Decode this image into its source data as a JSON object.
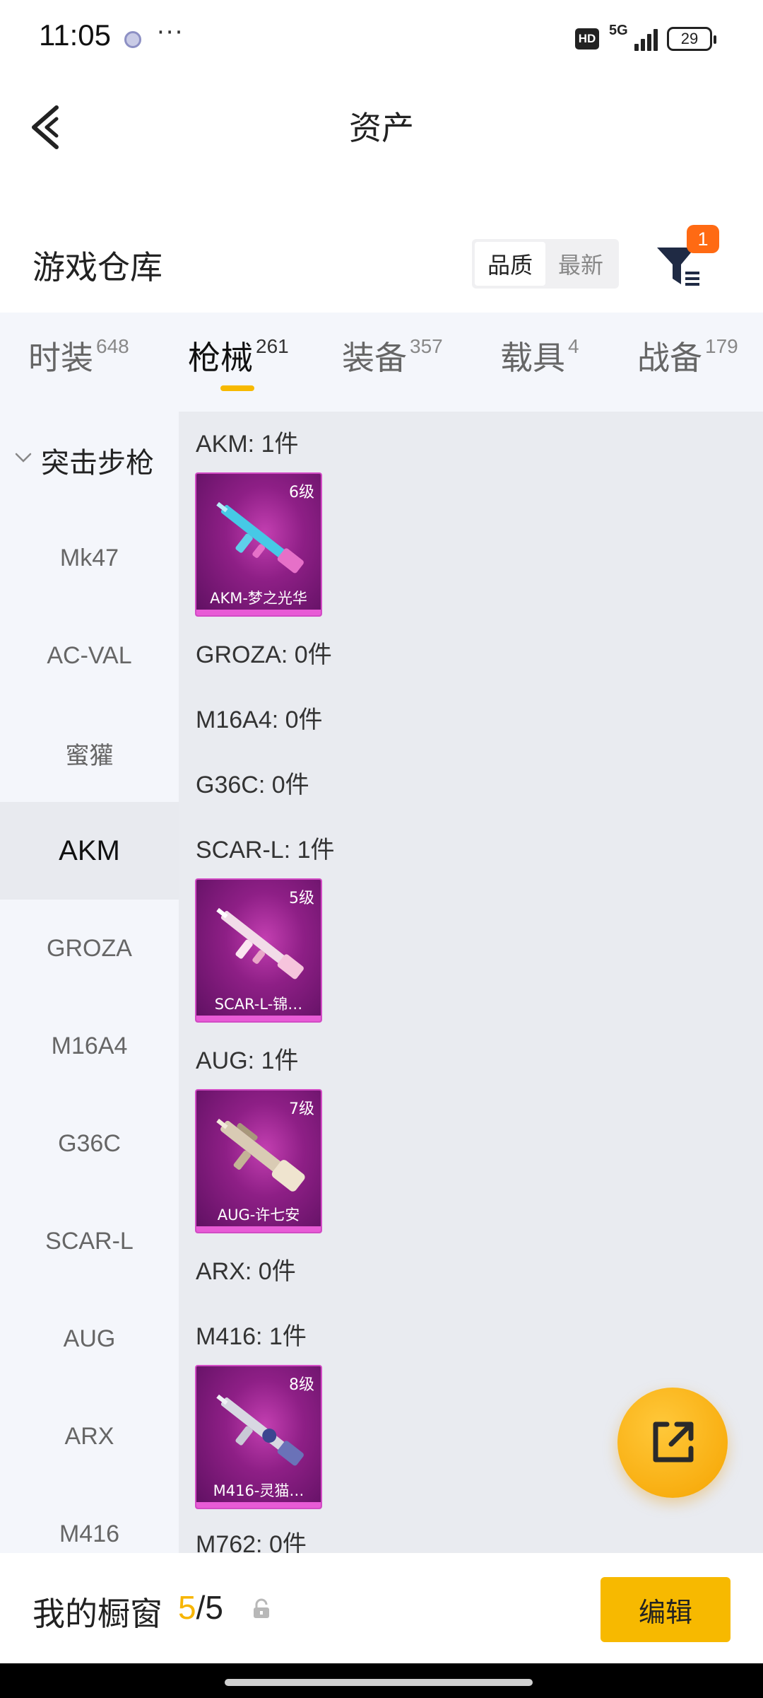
{
  "status_bar": {
    "time": "11:05",
    "dots": "···",
    "hd": "HD",
    "network": "5G",
    "battery": "29"
  },
  "header": {
    "title": "资产"
  },
  "warehouse": {
    "title": "游戏仓库",
    "sort_options": [
      "品质",
      "最新"
    ],
    "active_sort": "品质",
    "filter_badge": "1"
  },
  "tabs": [
    {
      "label": "时装",
      "count": "648"
    },
    {
      "label": "枪械",
      "count": "261",
      "active": true
    },
    {
      "label": "装备",
      "count": "357"
    },
    {
      "label": "载具",
      "count": "4"
    },
    {
      "label": "战备",
      "count": "179"
    }
  ],
  "sidebar": {
    "group": "突击步枪",
    "items": [
      "Mk47",
      "AC-VAL",
      "蜜獾",
      "AKM",
      "GROZA",
      "M16A4",
      "G36C",
      "SCAR-L",
      "AUG",
      "ARX",
      "M416"
    ],
    "active": "AKM"
  },
  "content": {
    "rows": [
      {
        "label": "AKM: 1件",
        "card": {
          "level": "6级",
          "name": "AKM-梦之光华"
        }
      },
      {
        "label": "GROZA: 0件"
      },
      {
        "label": "M16A4: 0件"
      },
      {
        "label": "G36C: 0件"
      },
      {
        "label": "SCAR-L: 1件",
        "card": {
          "level": "5级",
          "name": "SCAR-L-锦…"
        }
      },
      {
        "label": "AUG: 1件",
        "card": {
          "level": "7级",
          "name": "AUG-许七安"
        }
      },
      {
        "label": "ARX: 0件"
      },
      {
        "label": "M416: 1件",
        "card": {
          "level": "8级",
          "name": "M416-灵猫…"
        }
      },
      {
        "label": "M762: 0件"
      }
    ]
  },
  "bottom": {
    "showcase_label": "我的橱窗",
    "current": "5",
    "separator": "/",
    "max": "5",
    "edit_label": "编辑"
  },
  "colors": {
    "accent": "#f7b900",
    "badge": "#ff6a13",
    "card": "#8e1f86"
  }
}
